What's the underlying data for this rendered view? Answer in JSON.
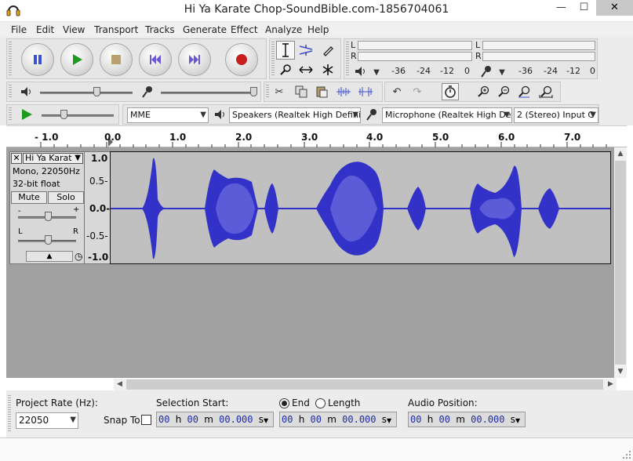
{
  "window": {
    "title": "Hi Ya Karate Chop-SoundBible.com-1856704061",
    "minimize": "—",
    "maximize": "☐",
    "close": "✕"
  },
  "menu": [
    "File",
    "Edit",
    "View",
    "Transport",
    "Tracks",
    "Generate",
    "Effect",
    "Analyze",
    "Help"
  ],
  "meters": {
    "play_labels": [
      "L",
      "R"
    ],
    "record_labels": [
      "L",
      "R"
    ],
    "play_scale": [
      "-36",
      "-24",
      "-12",
      "0"
    ],
    "record_scale": [
      "-36",
      "-24",
      "-12",
      "0"
    ]
  },
  "device": {
    "host": "MME",
    "output": "Speakers (Realtek High Definit",
    "input": "Microphone (Realtek High Defi",
    "channels": "2 (Stereo) Input C"
  },
  "ruler": {
    "ticks": [
      "- 1.0",
      "0.0",
      "1.0",
      "2.0",
      "3.0",
      "4.0",
      "5.0",
      "6.0",
      "7.0"
    ]
  },
  "track": {
    "name": "Hi Ya Karat",
    "info_format": "Mono, 22050Hz",
    "info_depth": "32-bit float",
    "mute": "Mute",
    "solo": "Solo",
    "gain_minus": "-",
    "gain_plus": "+",
    "pan_left": "L",
    "pan_right": "R",
    "scale": [
      "1.0",
      "0.5-",
      "0.0-",
      "-0.5-",
      "-1.0"
    ]
  },
  "selection": {
    "project_rate_label": "Project Rate (Hz):",
    "project_rate": "22050",
    "snap_to_label": "Snap To",
    "selection_start_label": "Selection Start:",
    "end_label": "End",
    "length_label": "Length",
    "audio_position_label": "Audio Position:",
    "time_start": {
      "h": "00",
      "m": "00",
      "s": "00.000"
    },
    "time_end": {
      "h": "00",
      "m": "00",
      "s": "00.000"
    },
    "time_position": {
      "h": "00",
      "m": "00",
      "s": "00.000"
    },
    "unit_h": "h",
    "unit_m": "m",
    "unit_s": "s"
  },
  "colors": {
    "waveform": "#3232c8",
    "waveform_rms": "#6464dc",
    "record_red": "#c81e1e",
    "play_green": "#1e9b1e",
    "transport_blue": "#3c50d2"
  }
}
